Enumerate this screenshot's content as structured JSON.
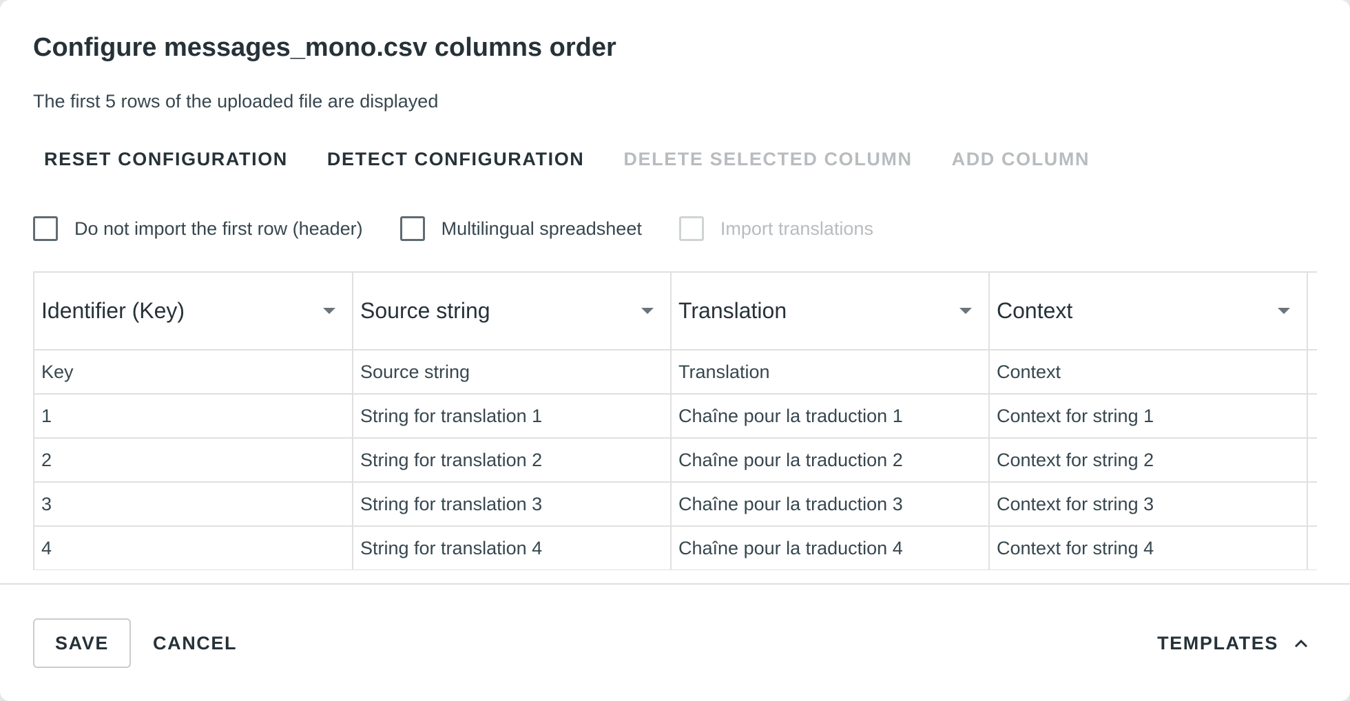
{
  "dialog": {
    "title": "Configure messages_mono.csv columns order",
    "subtitle": "The first 5 rows of the uploaded file are displayed"
  },
  "toolbar": {
    "reset_label": "RESET CONFIGURATION",
    "detect_label": "DETECT CONFIGURATION",
    "delete_label": "DELETE SELECTED COLUMN",
    "add_label": "ADD COLUMN"
  },
  "options": {
    "skip_header": {
      "label": "Do not import the first row (header)",
      "checked": false
    },
    "multilingual": {
      "label": "Multilingual spreadsheet",
      "checked": false
    },
    "import_translations": {
      "label": "Import translations",
      "checked": false,
      "disabled": true
    }
  },
  "table": {
    "columns": [
      {
        "label": "Identifier (Key)"
      },
      {
        "label": "Source string"
      },
      {
        "label": "Translation"
      },
      {
        "label": "Context"
      }
    ],
    "rows": [
      [
        "Key",
        "Source string",
        "Translation",
        "Context"
      ],
      [
        "1",
        "String for translation 1",
        "Chaîne pour la traduction 1",
        "Context for string 1"
      ],
      [
        "2",
        "String for translation 2",
        "Chaîne pour la traduction 2",
        "Context for string 2"
      ],
      [
        "3",
        "String for translation 3",
        "Chaîne pour la traduction 3",
        "Context for string 3"
      ],
      [
        "4",
        "String for translation 4",
        "Chaîne pour la traduction 4",
        "Context for string 4"
      ]
    ]
  },
  "footer": {
    "save_label": "SAVE",
    "cancel_label": "CANCEL",
    "templates_label": "TEMPLATES"
  },
  "icons": {
    "column_menu": "caret-down-icon",
    "templates": "chevron-up-icon"
  }
}
